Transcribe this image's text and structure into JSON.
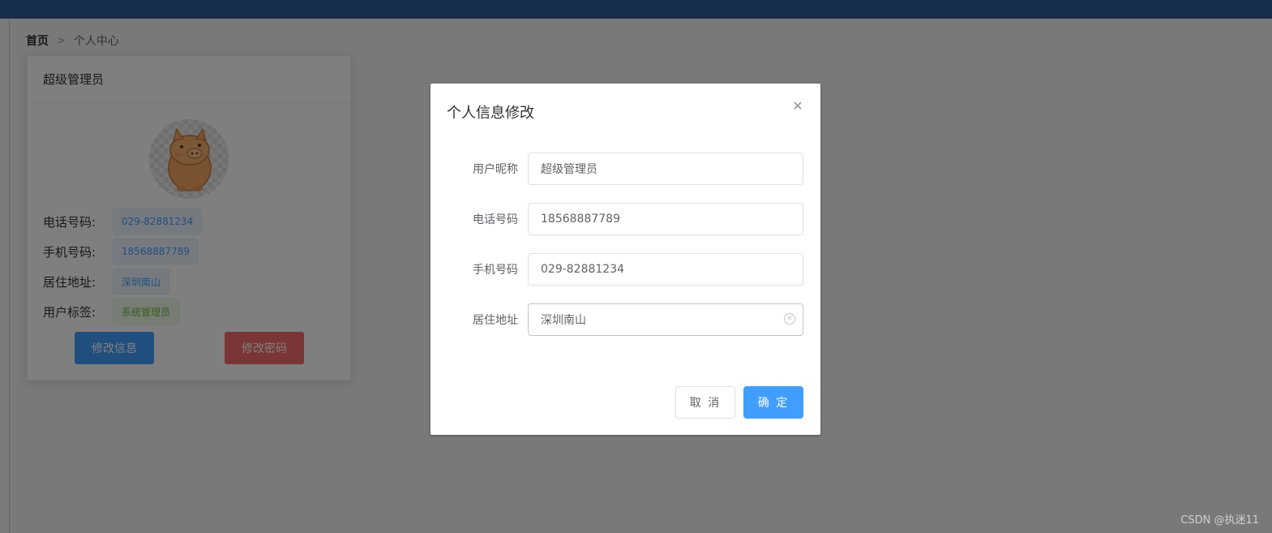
{
  "breadcrumb": {
    "home": "首页",
    "separator": ">",
    "current": "个人中心"
  },
  "profile_card": {
    "title": "超级管理员",
    "phone_label": "电话号码:",
    "phone_value": "029-82881234",
    "mobile_label": "手机号码:",
    "mobile_value": "18568887789",
    "address_label": "居住地址:",
    "address_value": "深圳南山",
    "tag_label": "用户标签:",
    "tag_value": "系统管理员",
    "edit_info_button": "修改信息",
    "edit_password_button": "修改密码"
  },
  "dialog": {
    "title": "个人信息修改",
    "close_icon": "close-icon",
    "fields": {
      "nickname": {
        "label": "用户昵称",
        "value": "超级管理员"
      },
      "phone": {
        "label": "电话号码",
        "value": "18568887789"
      },
      "mobile": {
        "label": "手机号码",
        "value": "029-82881234"
      },
      "address": {
        "label": "居住地址",
        "value": "深圳南山"
      }
    },
    "cancel_button": "取 消",
    "confirm_button": "确 定"
  },
  "watermark": "CSDN @执迷11",
  "colors": {
    "topbar": "#2a5c9a",
    "primary": "#409eff",
    "danger": "#f56c6c",
    "success": "#67c23a"
  }
}
